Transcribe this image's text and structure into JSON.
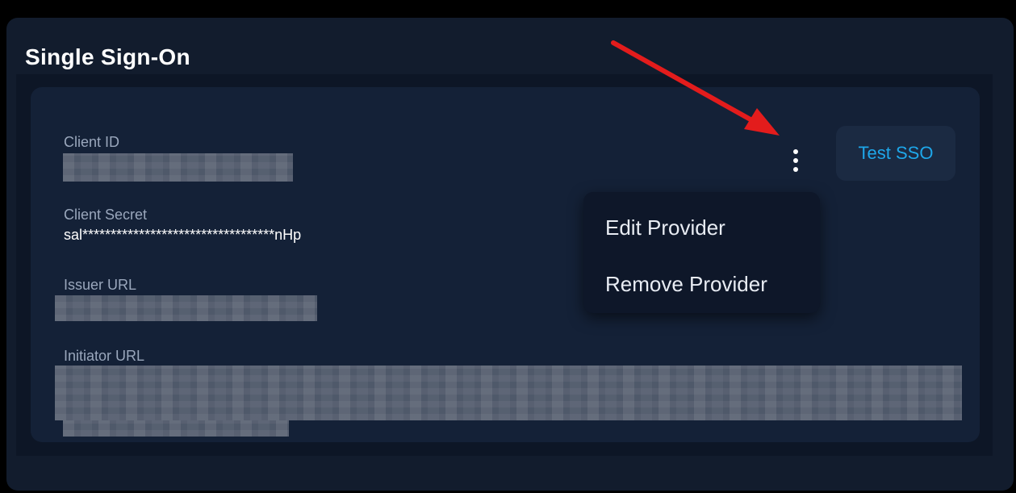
{
  "card": {
    "title": "Single Sign-On"
  },
  "provider": {
    "fields": [
      {
        "label": "Client ID",
        "value": ""
      },
      {
        "label": "Client Secret",
        "value": "sal**********************************nHp"
      },
      {
        "label": "Issuer URL",
        "value": ""
      },
      {
        "label": "Initiator URL",
        "value": ""
      }
    ],
    "test_button_label": "Test SSO",
    "menu_icon": "kebab-vertical-icon"
  },
  "menu": {
    "items": [
      {
        "label": "Edit Provider"
      },
      {
        "label": "Remove Provider"
      }
    ]
  },
  "annotation": {
    "arrow_color": "#e31c1c"
  },
  "colors": {
    "accent": "#1ea7ea",
    "card_bg": "#121c2d",
    "panel_bg": "#142137"
  }
}
